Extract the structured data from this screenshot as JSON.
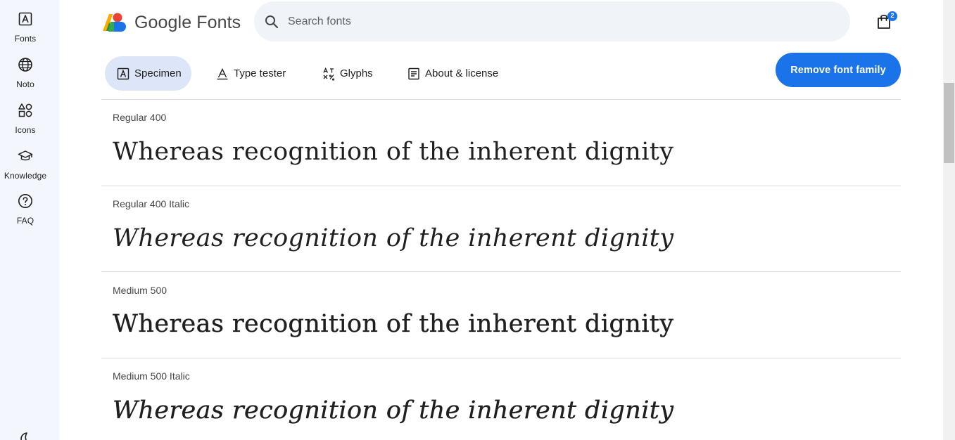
{
  "rail": {
    "items": [
      {
        "label": "Fonts",
        "icon": "fonts-icon"
      },
      {
        "label": "Noto",
        "icon": "globe-icon"
      },
      {
        "label": "Icons",
        "icon": "shapes-icon"
      },
      {
        "label": "Knowledge",
        "icon": "graduation-cap-icon"
      },
      {
        "label": "FAQ",
        "icon": "help-circle-icon"
      }
    ],
    "theme_icon": "moon-icon"
  },
  "header": {
    "logo_text": "Google Fonts",
    "search_placeholder": "Search fonts",
    "search_value": "",
    "bag_count": "2"
  },
  "tabs": [
    {
      "label": "Specimen",
      "icon": "specimen-icon",
      "active": true
    },
    {
      "label": "Type tester",
      "icon": "type-tester-icon",
      "active": false
    },
    {
      "label": "Glyphs",
      "icon": "glyphs-icon",
      "active": false
    },
    {
      "label": "About & license",
      "icon": "article-icon",
      "active": false
    }
  ],
  "actions": {
    "remove_label": "Remove font family"
  },
  "styles": [
    {
      "label": "Regular 400",
      "sample": "Whereas recognition of the inherent dignity"
    },
    {
      "label": "Regular 400 Italic",
      "sample": "Whereas recognition of the inherent dignity"
    },
    {
      "label": "Medium 500",
      "sample": "Whereas recognition of the inherent dignity"
    },
    {
      "label": "Medium 500 Italic",
      "sample": "Whereas recognition of the inherent dignity"
    }
  ],
  "colors": {
    "accent": "#1a73e8",
    "rail_bg": "#f3f6fc",
    "tab_active_bg": "#dde6f8",
    "search_bg": "#f0f4f9"
  }
}
